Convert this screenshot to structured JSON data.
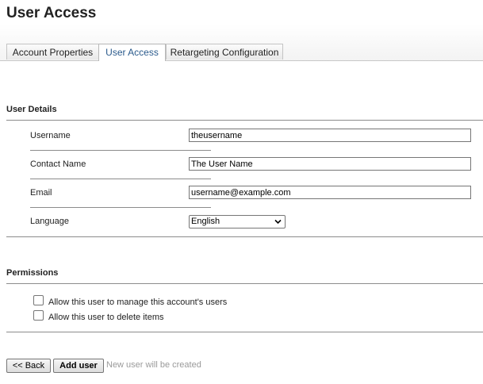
{
  "page": {
    "title": "User Access"
  },
  "tabs": [
    {
      "label": "Account Properties",
      "active": false
    },
    {
      "label": "User Access",
      "active": true
    },
    {
      "label": "Retargeting Configuration",
      "active": false
    }
  ],
  "user_details": {
    "title": "User Details",
    "username_label": "Username",
    "username_value": "theusername",
    "contact_label": "Contact Name",
    "contact_value": "The User Name",
    "email_label": "Email",
    "email_value": "username@example.com",
    "language_label": "Language",
    "language_value": "English"
  },
  "permissions": {
    "title": "Permissions",
    "manage_users_label": "Allow this user to manage this account's users",
    "manage_users_checked": false,
    "delete_items_label": "Allow this user to delete items",
    "delete_items_checked": false
  },
  "actions": {
    "back_label": "<< Back",
    "add_label": "Add user",
    "hint": "New user will be created"
  },
  "colors": {
    "active_tab_text": "#2a5a8c",
    "hint_text": "#9a9a9a"
  }
}
